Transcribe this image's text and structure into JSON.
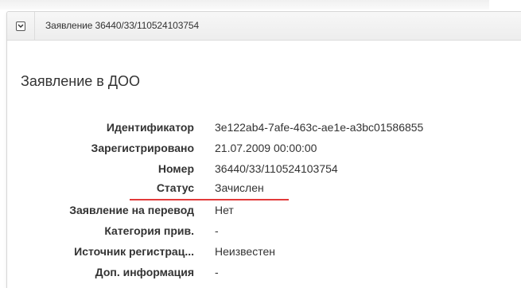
{
  "panel": {
    "header_title": "Заявление 36440/33/110524103754",
    "collapse_icon": "chevron-down-icon"
  },
  "page_title": "Заявление в ДОО",
  "details": [
    {
      "label": "Идентификатор",
      "value": "3e122ab4-7afe-463c-ae1e-a3bc01586855"
    },
    {
      "label": "Зарегистрировано",
      "value": "21.07.2009 00:00:00"
    },
    {
      "label": "Номер",
      "value": "36440/33/110524103754"
    },
    {
      "label": "Статус",
      "value": "Зачислен"
    },
    {
      "label": "Заявление на перевод",
      "value": "Нет"
    },
    {
      "label": "Категория прив.",
      "value": "-"
    },
    {
      "label": "Источник регистрац...",
      "value": "Неизвестен"
    },
    {
      "label": "Доп. информация",
      "value": "-"
    }
  ],
  "colors": {
    "status_underline": "#e23a3a",
    "text": "#333333"
  }
}
